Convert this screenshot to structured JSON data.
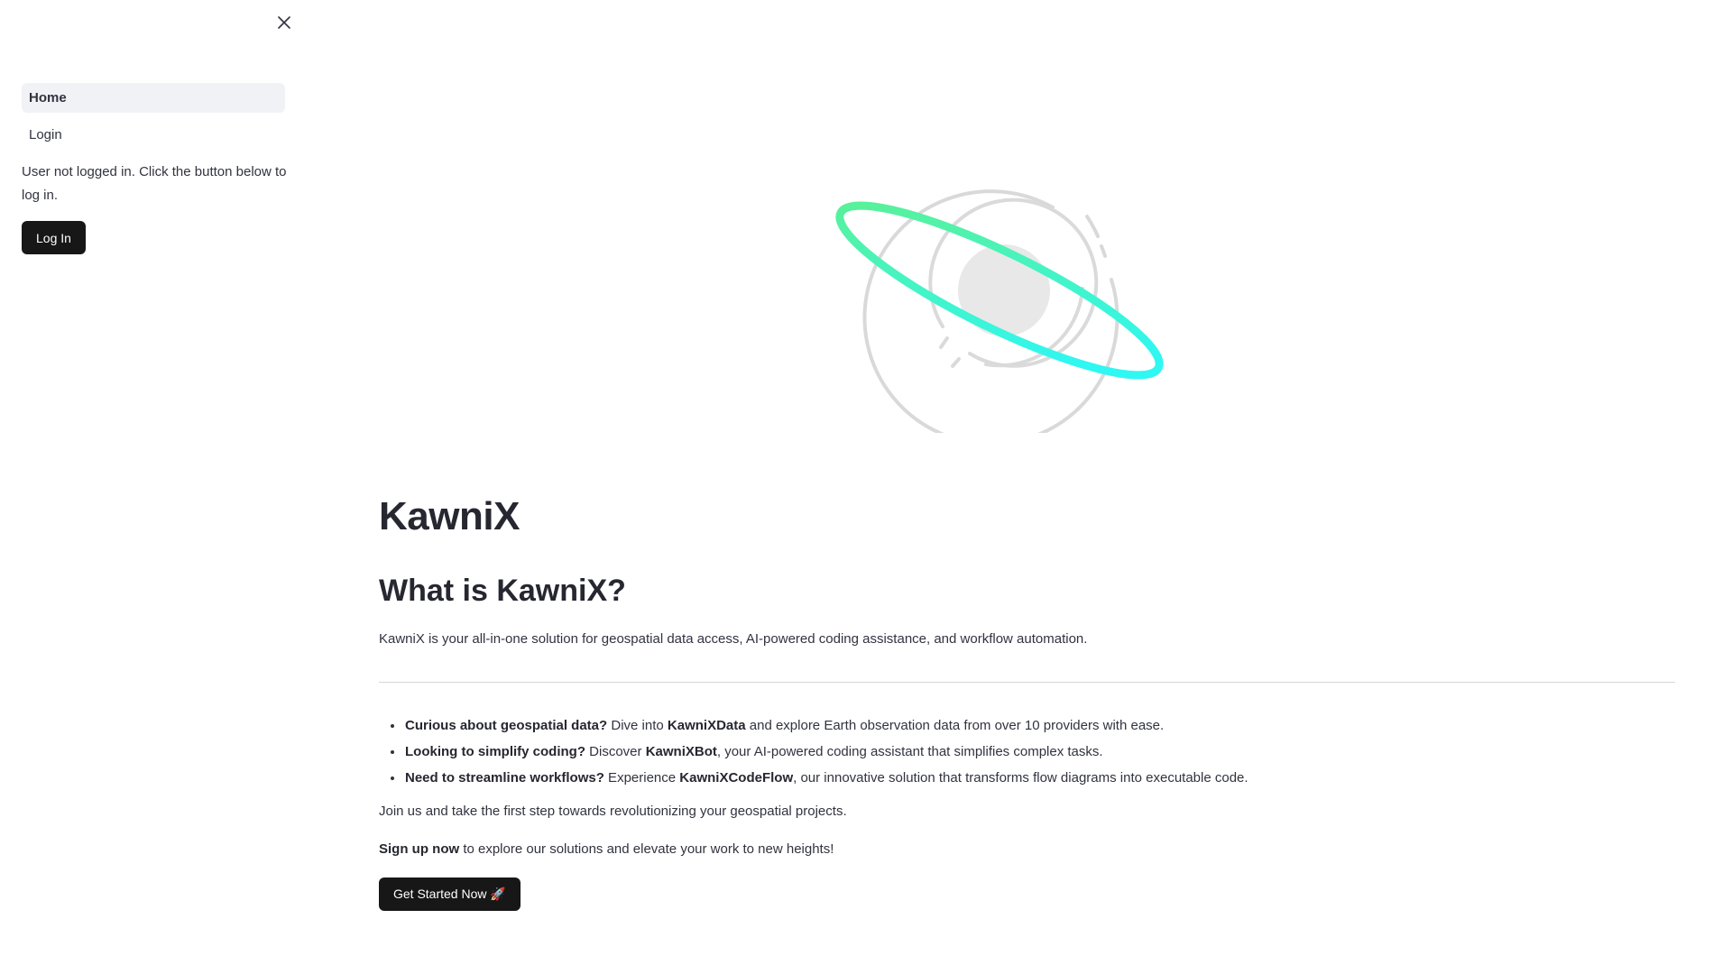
{
  "sidebar": {
    "close_icon": "close-icon",
    "nav_items": [
      {
        "label": "Home",
        "active": true
      },
      {
        "label": "Login",
        "active": false
      }
    ],
    "login_message": "User not logged in. Click the button below to log in.",
    "login_button": "Log In"
  },
  "main": {
    "logo_icon": "planet-ring-logo",
    "title": "KawniX",
    "subtitle": "What is KawniX?",
    "intro": "KawniX is your all-in-one solution for geospatial data access, AI-powered coding assistance, and workflow automation.",
    "features": [
      {
        "lead": "Curious about geospatial data?",
        "pre": " Dive into ",
        "product": "KawniXData",
        "post": " and explore Earth observation data from over 10 providers with ease."
      },
      {
        "lead": "Looking to simplify coding?",
        "pre": " Discover ",
        "product": "KawniXBot",
        "post": ", your AI-powered coding assistant that simplifies complex tasks."
      },
      {
        "lead": "Need to streamline workflows?",
        "pre": " Experience ",
        "product": "KawniXCodeFlow",
        "post": ", our innovative solution that transforms flow diagrams into executable code."
      }
    ],
    "join_text": "Join us and take the first step towards revolutionizing your geospatial projects.",
    "signup_bold": "Sign up now",
    "signup_rest": " to explore our solutions and elevate your work to new heights!",
    "cta_button": "Get Started Now 🚀"
  },
  "colors": {
    "button_bg": "#171717",
    "active_nav_bg": "#f0f2f6",
    "ring_start": "#5ef08f",
    "ring_end": "#2ff7f2",
    "logo_gray": "#d9d9d9"
  }
}
